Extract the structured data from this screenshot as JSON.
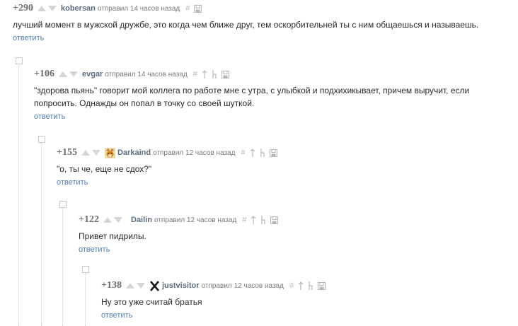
{
  "comments": [
    {
      "rating": "+290",
      "author": "kobersan",
      "meta": "отправил 14 часов назад",
      "text": "лучший момент в мужской дружбе, это когда чем ближе друг, тем оскорбительней ты с ним общаешься и называешь.",
      "reply": "ответить",
      "avatar": "none",
      "hash": "#"
    },
    {
      "rating": "+106",
      "author": "evgar",
      "meta": "отправил 14 часов назад",
      "text_lines": [
        "\"здорова пьянь\" говорит мой коллега по работе мне с утра, с улыбкой и подхихикывает,  причем выручит, если",
        "попросить. Однажды он попал в точку со своей шуткой."
      ],
      "reply": "ответить",
      "avatar": "none",
      "hash": "#"
    },
    {
      "rating": "+155",
      "author": "Darkaind",
      "meta": "отправил 12 часов назад",
      "text": "\"о, ты че, еще не сдох?\"",
      "reply": "ответить",
      "avatar": "fox-avatar-icon",
      "hash": "#"
    },
    {
      "rating": "+122",
      "author": "Dailin",
      "meta": "отправил 12 часов назад",
      "text": "Привет пидрилы.",
      "reply": "ответить",
      "avatar": "none",
      "hash": "#"
    },
    {
      "rating": "+138",
      "author": "justvisitor",
      "meta": "отправил 12 часов назад",
      "text": "Ну это уже считай братья",
      "reply": "ответить",
      "avatar": "x-avatar-icon",
      "hash": "#"
    }
  ],
  "colors": {
    "author": "#5b6e80",
    "reply_link": "#4f7db0",
    "vote_arrow": "#d5d5d5",
    "rating": "#6d6d6d"
  }
}
